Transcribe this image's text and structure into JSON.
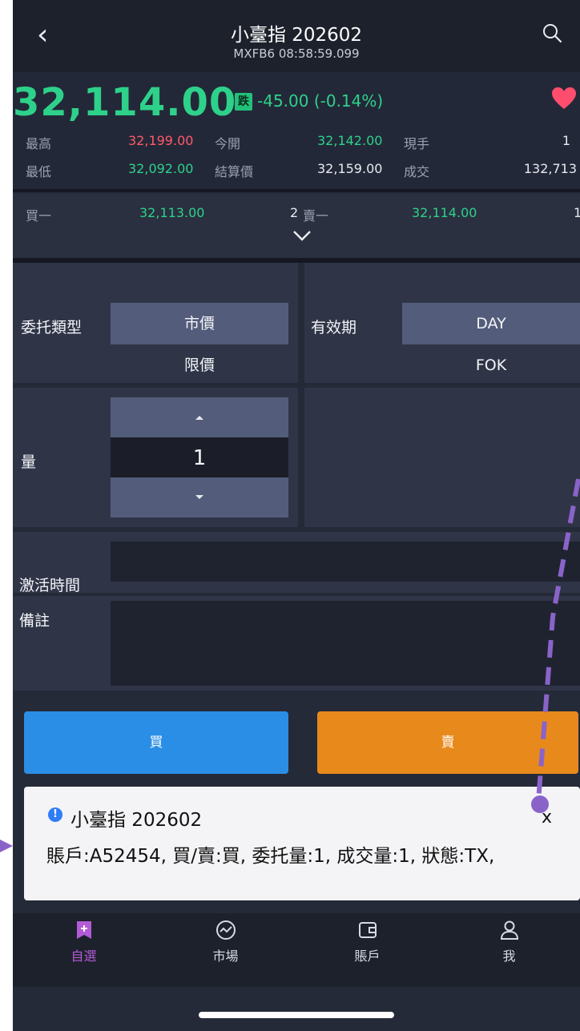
{
  "header": {
    "title": "小臺指 202602",
    "subtitle": "MXFB6  08:58:59.099"
  },
  "quote": {
    "price": "32,114.00",
    "badge": "跌",
    "change": "-45.00 (-0.14%)",
    "high_label": "最高",
    "high_value": "32,199.00",
    "open_label": "今開",
    "open_value": "32,142.00",
    "last_qty_label": "現手",
    "last_qty_value": "1",
    "low_label": "最低",
    "low_value": "32,092.00",
    "settle_label": "結算價",
    "settle_value": "32,159.00",
    "volume_label": "成交",
    "volume_value": "132,713",
    "bid_label": "買一",
    "bid_price": "32,113.00",
    "bid_qty": "2",
    "ask_label": "賣一",
    "ask_price": "32,114.00",
    "ask_qty": "1"
  },
  "form": {
    "order_type_label": "委托類型",
    "order_type_options": [
      "市價",
      "限價"
    ],
    "validity_label": "有效期",
    "validity_options": [
      "DAY",
      "FOK"
    ],
    "qty_label": "量",
    "qty_value": "1",
    "activation_label": "激活時間",
    "note_label": "備註"
  },
  "actions": {
    "buy_label": "買",
    "sell_label": "賣"
  },
  "notification": {
    "title": "小臺指 202602",
    "close": "x",
    "body": "賬戶:A52454, 買/賣:買, 委托量:1, 成交量:1, 狀態:TX,"
  },
  "nav": {
    "items": [
      {
        "label": "自選",
        "icon": "watchlist-icon",
        "active": true
      },
      {
        "label": "市場",
        "icon": "market-icon",
        "active": false
      },
      {
        "label": "賬戶",
        "icon": "wallet-icon",
        "active": false
      },
      {
        "label": "我",
        "icon": "profile-icon",
        "active": false
      }
    ]
  },
  "colors": {
    "up": "#ff5a6a",
    "down": "#2ed18a",
    "buy": "#2b8ee6",
    "sell": "#e8891c",
    "active_nav": "#b35bd6",
    "annotation": "#8a63c9"
  }
}
